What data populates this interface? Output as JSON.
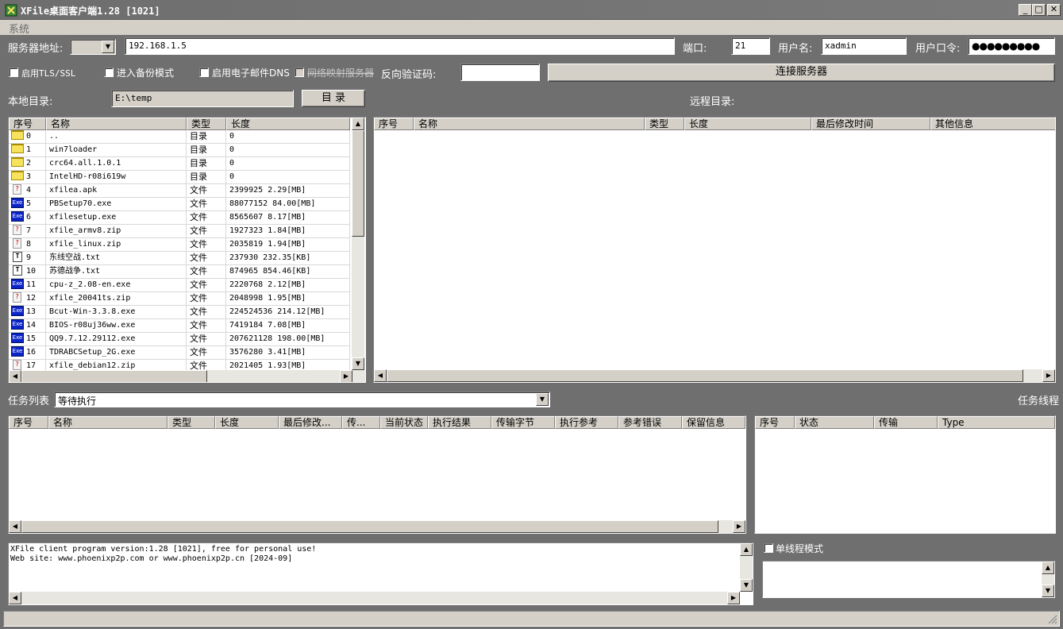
{
  "window": {
    "title": "XFile桌面客户端1.28 [1021]",
    "min": "_",
    "max": "□",
    "close": "✕"
  },
  "menu": {
    "system": "系统"
  },
  "server": {
    "address_label": "服务器地址:",
    "address_value": "192.168.1.5",
    "port_label": "端口:",
    "port_value": "21",
    "user_label": "用户名:",
    "user_value": "xadmin",
    "password_label": "用户口令:",
    "password_value": "●●●●●●●●●"
  },
  "options": {
    "tls": "启用TLS/SSL",
    "backup": "进入备份模式",
    "email_dns": "启用电子邮件DNS",
    "disabled_option": "网络映射服务器",
    "reverse_code_label": "反向验证码:",
    "connect_button": "连接服务器"
  },
  "local": {
    "label": "本地目录:",
    "path": "E:\\temp",
    "dir_button": "目 录"
  },
  "remote": {
    "label": "远程目录:"
  },
  "local_columns": [
    "序号",
    "名称",
    "类型",
    "长度"
  ],
  "local_files": [
    {
      "no": "0",
      "name": "..",
      "type": "目录",
      "size": "0",
      "icon": "folder"
    },
    {
      "no": "1",
      "name": "win7loader",
      "type": "目录",
      "size": "0",
      "icon": "folder"
    },
    {
      "no": "2",
      "name": "crc64.all.1.0.1",
      "type": "目录",
      "size": "0",
      "icon": "folder"
    },
    {
      "no": "3",
      "name": "IntelHD-r08i619w",
      "type": "目录",
      "size": "0",
      "icon": "folder"
    },
    {
      "no": "4",
      "name": "xfilea.apk",
      "type": "文件",
      "size": "2399925  2.29[MB]",
      "icon": "unknown"
    },
    {
      "no": "5",
      "name": "PBSetup70.exe",
      "type": "文件",
      "size": "88077152  84.00[MB]",
      "icon": "exe"
    },
    {
      "no": "6",
      "name": "xfilesetup.exe",
      "type": "文件",
      "size": "8565607  8.17[MB]",
      "icon": "exe"
    },
    {
      "no": "7",
      "name": "xfile_armv8.zip",
      "type": "文件",
      "size": "1927323  1.84[MB]",
      "icon": "unknown"
    },
    {
      "no": "8",
      "name": "xfile_linux.zip",
      "type": "文件",
      "size": "2035819  1.94[MB]",
      "icon": "unknown"
    },
    {
      "no": "9",
      "name": "东线空战.txt",
      "type": "文件",
      "size": "237930  232.35[KB]",
      "icon": "txt"
    },
    {
      "no": "10",
      "name": "苏德战争.txt",
      "type": "文件",
      "size": "874965  854.46[KB]",
      "icon": "txt"
    },
    {
      "no": "11",
      "name": "cpu-z_2.08-en.exe",
      "type": "文件",
      "size": "2220768  2.12[MB]",
      "icon": "exe"
    },
    {
      "no": "12",
      "name": "xfile_20041ts.zip",
      "type": "文件",
      "size": "2048998  1.95[MB]",
      "icon": "unknown"
    },
    {
      "no": "13",
      "name": "Bcut-Win-3.3.8.exe",
      "type": "文件",
      "size": "224524536  214.12[MB]",
      "icon": "exe"
    },
    {
      "no": "14",
      "name": "BIOS-r08uj36ww.exe",
      "type": "文件",
      "size": "7419184  7.08[MB]",
      "icon": "exe"
    },
    {
      "no": "15",
      "name": "QQ9.7.12.29112.exe",
      "type": "文件",
      "size": "207621128  198.00[MB]",
      "icon": "exe"
    },
    {
      "no": "16",
      "name": "TDRABCSetup_2G.exe",
      "type": "文件",
      "size": "3576280  3.41[MB]",
      "icon": "exe"
    },
    {
      "no": "17",
      "name": "xfile_debian12.zip",
      "type": "文件",
      "size": "2021405  1.93[MB]",
      "icon": "unknown"
    }
  ],
  "remote_columns": [
    "序号",
    "名称",
    "类型",
    "长度",
    "最后修改时间",
    "其他信息"
  ],
  "tasks": {
    "label": "任务列表",
    "filter_value": "等待执行",
    "threads_label": "任务线程"
  },
  "task_columns": [
    "序号",
    "名称",
    "类型",
    "长度",
    "最后修改...",
    "传...",
    "当前状态",
    "执行结果",
    "传输字节",
    "执行参考",
    "参考错误",
    "保留信息"
  ],
  "thread_columns": [
    "序号",
    "状态",
    "传输",
    "Type"
  ],
  "log": [
    "XFile client program version:1.28 [1021], free for personal use!",
    "Web site: www.phoenixp2p.com or www.phoenixp2p.cn [2024-09]"
  ],
  "single_thread": "单线程模式",
  "icons": {
    "folder": "folder-icon",
    "exe": "exe-icon",
    "unknown": "unknown-file-icon",
    "txt": "text-file-icon"
  }
}
